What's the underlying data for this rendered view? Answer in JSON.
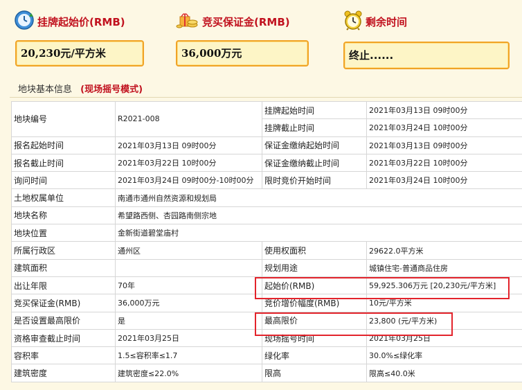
{
  "stats": {
    "start_price": {
      "label": "挂牌起始价(RMB)",
      "value": "20,230元/平方米"
    },
    "deposit": {
      "label": "竞买保证金(RMB)",
      "value": "36,000万元"
    },
    "remaining": {
      "label": "剩余时间",
      "value": "终止......"
    }
  },
  "section": {
    "title": "地块基本信息",
    "mode": "(现场摇号模式)"
  },
  "table": {
    "parcel_no_label": "地块编号",
    "parcel_no": "R2021-008",
    "rows": [
      {
        "k1": "",
        "v1": "",
        "k2": "挂牌起始时间",
        "v2": "2021年03月13日 09时00分"
      },
      {
        "k1": "",
        "v1": "",
        "k2": "挂牌截止时间",
        "v2": "2021年03月24日 10时00分"
      },
      {
        "k1": "报名起始时间",
        "v1": "2021年03月13日 09时00分",
        "k2": "保证金缴纳起始时间",
        "v2": "2021年03月13日 09时00分"
      },
      {
        "k1": "报名截止时间",
        "v1": "2021年03月22日 10时00分",
        "k2": "保证金缴纳截止时间",
        "v2": "2021年03月22日 10时00分"
      },
      {
        "k1": "询问时间",
        "v1": "2021年03月24日 09时00分-10时00分",
        "k2": "限时竞价开始时间",
        "v2": "2021年03月24日 10时00分"
      },
      {
        "k1": "土地权属单位",
        "v1": "南通市通州自然资源和规划局",
        "k2": "",
        "v2": ""
      },
      {
        "k1": "地块名称",
        "v1": "希望路西侧、杏园路南侧宗地",
        "k2": "",
        "v2": ""
      },
      {
        "k1": "地块位置",
        "v1": "金新街道碧堂庙村",
        "k2": "",
        "v2": ""
      },
      {
        "k1": "所属行政区",
        "v1": "通州区",
        "k2": "使用权面积",
        "v2": "29622.0平方米"
      },
      {
        "k1": "建筑面积",
        "v1": "",
        "k2": "规划用途",
        "v2": "城镇住宅-普通商品住房"
      },
      {
        "k1": "出让年限",
        "v1": "70年",
        "k2": "起始价(RMB)",
        "v2": "59,925.306万元 [20,230元/平方米]"
      },
      {
        "k1": "竞买保证金(RMB)",
        "v1": "36,000万元",
        "k2": "竞价增价幅度(RMB)",
        "v2": "10元/平方米"
      },
      {
        "k1": "是否设置最高限价",
        "v1": "是",
        "k2": "最高限价",
        "v2": "23,800 (元/平方米)"
      },
      {
        "k1": "资格审查截止时间",
        "v1": "2021年03月25日",
        "k2": "现场摇号时间",
        "v2": "2021年03月25日"
      },
      {
        "k1": "容积率",
        "v1": "1.5≤容积率≤1.7",
        "k2": "绿化率",
        "v2": "30.0%≤绿化率"
      },
      {
        "k1": "建筑密度",
        "v1": "建筑密度≤22.0%",
        "k2": "限高",
        "v2": "限高≤40.0米"
      }
    ]
  },
  "colors": {
    "accent_red": "#c1121f",
    "box_border": "#f0a326",
    "highlight": "#e3232b"
  },
  "icons": {
    "start_price": "clock-refresh-icon",
    "deposit": "gift-coins-icon",
    "remaining": "alarm-clock-icon"
  }
}
